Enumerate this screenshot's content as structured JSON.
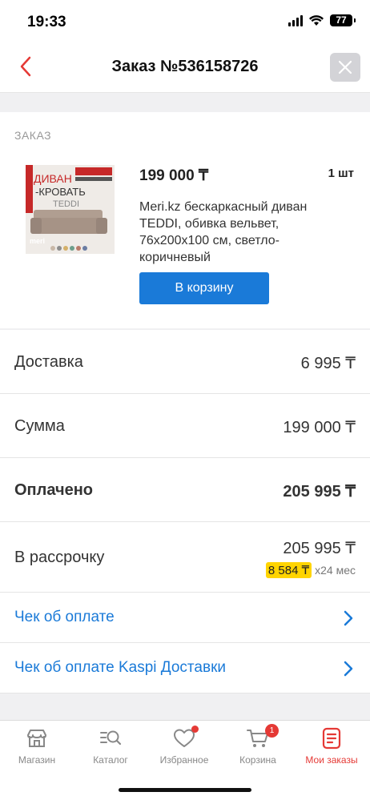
{
  "status": {
    "time": "19:33",
    "battery": "77"
  },
  "nav": {
    "title": "Заказ №536158726"
  },
  "order": {
    "section_label": "ЗАКАЗ",
    "product": {
      "price": "199 000 ₸",
      "quantity": "1 шт",
      "name": "Meri.kz бескаркасный диван TEDDI, обивка вельвет, 76x200x100 см, светло-коричневый",
      "image_text": {
        "line1": "ДИВАН",
        "line2": "-КРОВАТЬ",
        "line3": "TEDDI",
        "brand": "meri"
      },
      "cart_button": "В корзину"
    }
  },
  "summary": {
    "delivery": {
      "label": "Доставка",
      "value": "6 995 ₸"
    },
    "sum": {
      "label": "Сумма",
      "value": "199 000 ₸"
    },
    "paid": {
      "label": "Оплачено",
      "value": "205 995 ₸"
    },
    "installment": {
      "label": "В рассрочку",
      "value": "205 995 ₸",
      "monthly": "8 584 ₸",
      "term": "x24 мес"
    }
  },
  "links": {
    "receipt": "Чек об оплате",
    "delivery_receipt": "Чек об оплате Kaspi Доставки"
  },
  "tabs": [
    {
      "label": "Магазин",
      "icon": "shop-icon"
    },
    {
      "label": "Каталог",
      "icon": "catalog-search-icon"
    },
    {
      "label": "Избранное",
      "icon": "heart-icon"
    },
    {
      "label": "Корзина",
      "icon": "cart-icon",
      "badge": "1"
    },
    {
      "label": "Мои заказы",
      "icon": "orders-icon"
    }
  ],
  "colors": {
    "accent_red": "#e53935",
    "link_blue": "#1a7ad8",
    "installment_yellow": "#ffd400"
  }
}
